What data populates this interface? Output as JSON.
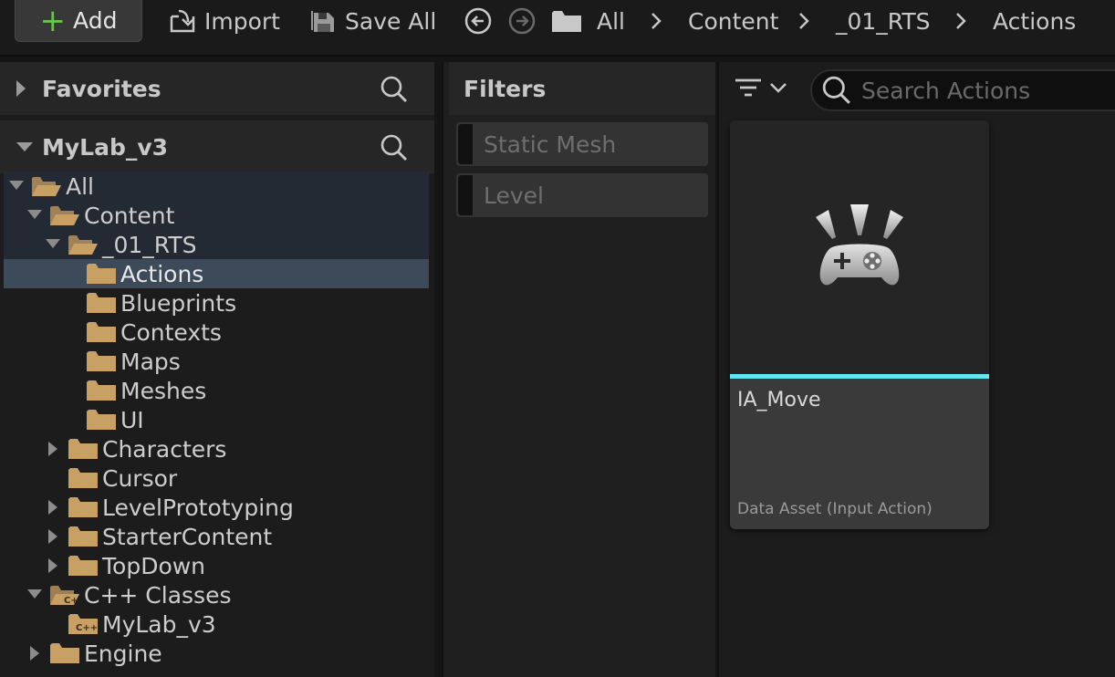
{
  "toolbar": {
    "add_label": "Add",
    "import_label": "Import",
    "save_all_label": "Save All"
  },
  "breadcrumb": [
    "All",
    "Content",
    "_01_RTS",
    "Actions"
  ],
  "sources": {
    "favorites_label": "Favorites",
    "project_label": "MyLab_v3"
  },
  "tree": [
    {
      "label": "All",
      "depth": 0,
      "expanded": true,
      "folder": "open"
    },
    {
      "label": "Content",
      "depth": 1,
      "expanded": true,
      "folder": "open"
    },
    {
      "label": "_01_RTS",
      "depth": 2,
      "expanded": true,
      "folder": "open"
    },
    {
      "label": "Actions",
      "depth": 3,
      "selected": true,
      "folder": "closed"
    },
    {
      "label": "Blueprints",
      "depth": 3,
      "folder": "closed"
    },
    {
      "label": "Contexts",
      "depth": 3,
      "folder": "closed"
    },
    {
      "label": "Maps",
      "depth": 3,
      "folder": "closed"
    },
    {
      "label": "Meshes",
      "depth": 3,
      "folder": "closed"
    },
    {
      "label": "UI",
      "depth": 3,
      "folder": "closed"
    },
    {
      "label": "Characters",
      "depth": 2,
      "collapsed": true,
      "folder": "closed"
    },
    {
      "label": "Cursor",
      "depth": 2,
      "folder": "closed"
    },
    {
      "label": "LevelPrototyping",
      "depth": 2,
      "collapsed": true,
      "folder": "closed"
    },
    {
      "label": "StarterContent",
      "depth": 2,
      "collapsed": true,
      "folder": "closed"
    },
    {
      "label": "TopDown",
      "depth": 2,
      "collapsed": true,
      "folder": "closed"
    },
    {
      "label": "C++ Classes",
      "depth": 1,
      "expanded": true,
      "folder": "open-cpp"
    },
    {
      "label": "MyLab_v3",
      "depth": 2,
      "folder": "cpp"
    },
    {
      "label": "Engine",
      "depth": 1,
      "collapsed": true,
      "folder": "closed"
    }
  ],
  "filters": {
    "title": "Filters",
    "items": [
      "Static Mesh",
      "Level"
    ]
  },
  "search": {
    "placeholder": "Search Actions"
  },
  "assets": [
    {
      "name": "IA_Move",
      "type": "Data Asset (Input Action)",
      "accent_color": "#62e6f0",
      "icon": "gamepad-icon"
    }
  ],
  "colors": {
    "folder": "#c9a063",
    "add_plus": "#66c34b",
    "selection": "#3d4a5a"
  }
}
